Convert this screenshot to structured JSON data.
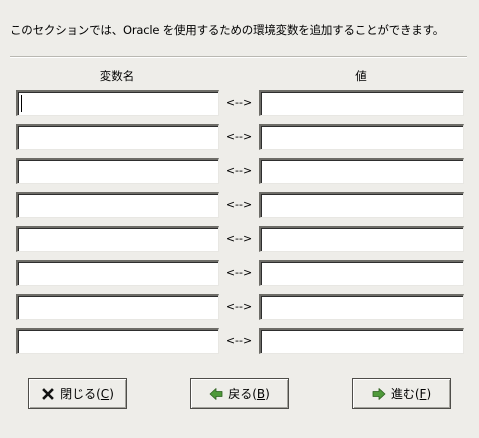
{
  "description": "このセクションでは、Oracle を使用するための環境変数を追加することができます。",
  "columns": {
    "name": "変数名",
    "value": "値"
  },
  "rows": [
    {
      "name": "",
      "value": "",
      "arrow": "<-->"
    },
    {
      "name": "",
      "value": "",
      "arrow": "<-->"
    },
    {
      "name": "",
      "value": "",
      "arrow": "<-->"
    },
    {
      "name": "",
      "value": "",
      "arrow": "<-->"
    },
    {
      "name": "",
      "value": "",
      "arrow": "<-->"
    },
    {
      "name": "",
      "value": "",
      "arrow": "<-->"
    },
    {
      "name": "",
      "value": "",
      "arrow": "<-->"
    },
    {
      "name": "",
      "value": "",
      "arrow": "<-->"
    }
  ],
  "buttons": {
    "close": {
      "label": "閉じる(",
      "mnemonic": "C",
      "suffix": ")",
      "icon": "close-x-icon"
    },
    "back": {
      "label": "戻る(",
      "mnemonic": "B",
      "suffix": ")",
      "icon": "arrow-left-icon"
    },
    "next": {
      "label": "進む(",
      "mnemonic": "F",
      "suffix": ")",
      "icon": "arrow-right-icon"
    }
  },
  "colors": {
    "background": "#eeede9",
    "icon_green": "#4f9a3a"
  }
}
